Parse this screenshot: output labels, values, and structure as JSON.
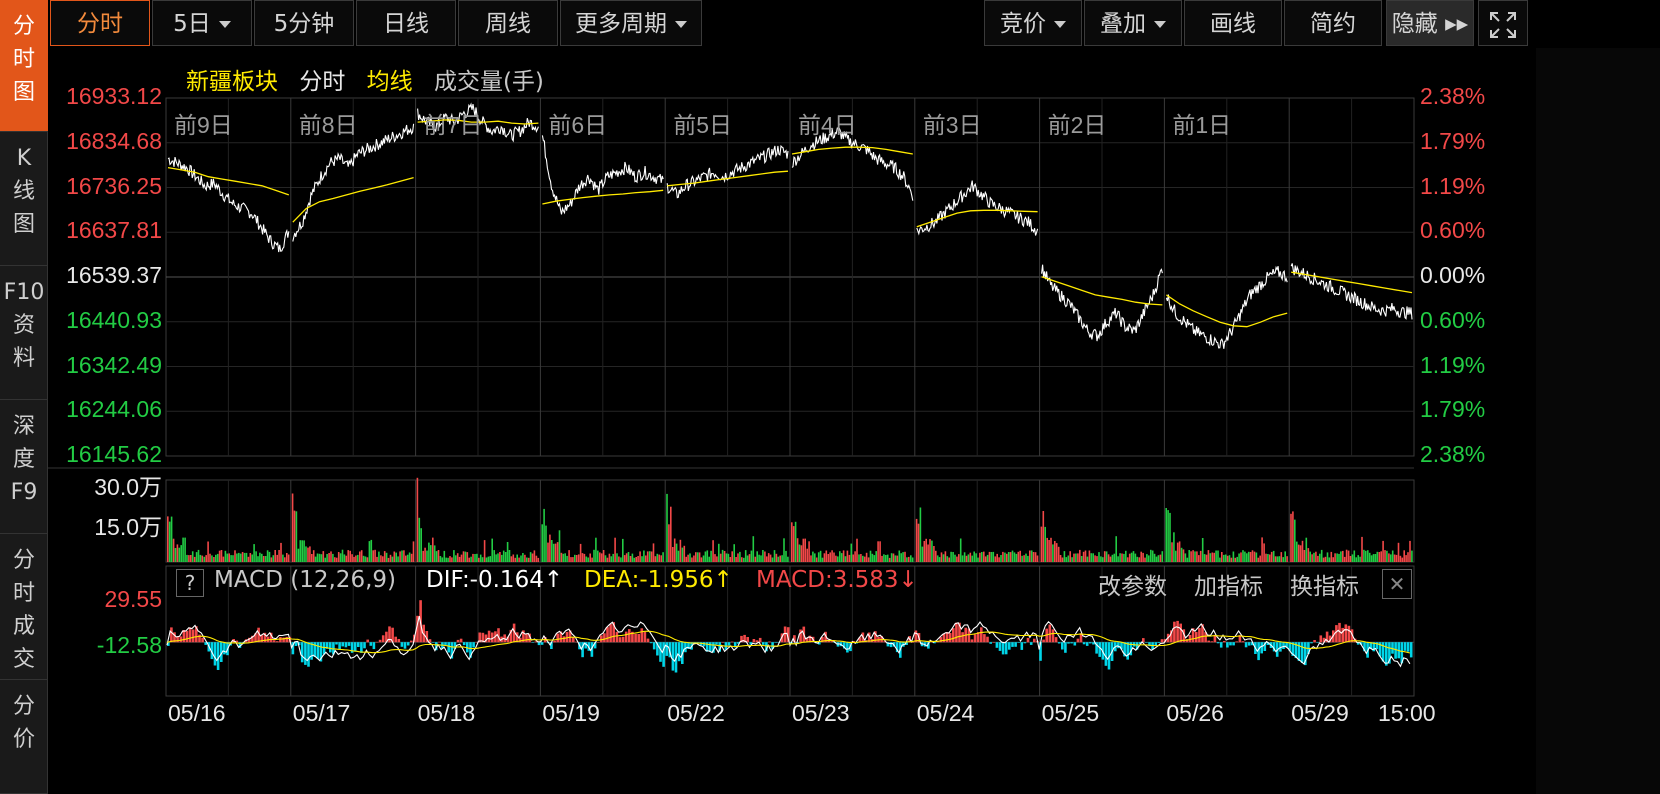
{
  "sidebar": {
    "items": [
      {
        "label": [
          "分",
          "时",
          "图"
        ],
        "active": true
      },
      {
        "label": [
          "K",
          "线",
          "图"
        ],
        "active": false
      },
      {
        "label": [
          "F10",
          "资",
          "料"
        ],
        "active": false
      },
      {
        "label": [
          "深",
          "度",
          "F9"
        ],
        "active": false
      },
      {
        "label": [
          "分",
          "时",
          "成",
          "交"
        ],
        "active": false
      },
      {
        "label": [
          "分",
          "价"
        ],
        "active": false
      }
    ]
  },
  "toolbar": {
    "tabs": [
      {
        "label": "分时",
        "active": true,
        "dropdown": false
      },
      {
        "label": "5日",
        "active": false,
        "dropdown": true
      },
      {
        "label": "5分钟",
        "active": false,
        "dropdown": false
      },
      {
        "label": "日线",
        "active": false,
        "dropdown": false
      },
      {
        "label": "周线",
        "active": false,
        "dropdown": false
      },
      {
        "label": "更多周期",
        "active": false,
        "dropdown": true
      }
    ],
    "right": [
      {
        "label": "竞价",
        "dropdown": true
      },
      {
        "label": "叠加",
        "dropdown": true
      },
      {
        "label": "画线",
        "dropdown": false
      },
      {
        "label": "简约",
        "dropdown": false
      },
      {
        "label": "隐藏 ▸▸",
        "dropdown": false
      }
    ],
    "expand_icon": "fullscreen-icon"
  },
  "legend": {
    "name": "新疆板块",
    "mode": "分时",
    "avg": "均线",
    "volume_label": "成交量(手)"
  },
  "macd": {
    "help": "?",
    "name": "MACD (12,26,9)",
    "dif": "DIF:-0.164↑",
    "dea": "DEA:-1.956↑",
    "macd": "MACD:3.583↓",
    "btn_params": "改参数",
    "btn_add": "加指标",
    "btn_switch": "换指标",
    "close": "✕"
  },
  "colors": {
    "up": "#f24848",
    "down": "#22cc44",
    "price_line": "#ffffff",
    "avg_line": "#ffea00",
    "macd_neg": "#00d5e8",
    "accent": "#e2561a"
  },
  "chart_data": {
    "type": "line",
    "title": "新疆板块 分时 5日",
    "y_ticks_left": [
      "16933.12",
      "16834.68",
      "16736.25",
      "16637.81",
      "16539.37",
      "16440.93",
      "16342.49",
      "16244.06",
      "16145.62"
    ],
    "y_ticks_right": [
      "2.38%",
      "1.79%",
      "1.19%",
      "0.60%",
      "0.00%",
      "0.60%",
      "1.19%",
      "1.79%",
      "2.38%"
    ],
    "ylim": [
      16145.62,
      16933.12
    ],
    "prev_close": 16539.37,
    "day_labels": [
      "前9日",
      "前8日",
      "前7日",
      "前6日",
      "前5日",
      "前4日",
      "前3日",
      "前2日",
      "前1日",
      ""
    ],
    "x_labels": [
      "05/16",
      "05/17",
      "05/18",
      "05/19",
      "05/22",
      "05/23",
      "05/24",
      "05/25",
      "05/26",
      "05/29",
      "15:00"
    ],
    "days": [
      {
        "price": [
          16800,
          16790,
          16780,
          16760,
          16740,
          16745,
          16720,
          16700,
          16690,
          16680,
          16650,
          16620,
          16600,
          16640
        ],
        "avg": [
          16780,
          16775,
          16770,
          16760,
          16755,
          16750,
          16745,
          16740,
          16730,
          16720
        ]
      },
      {
        "price": [
          16630,
          16660,
          16720,
          16760,
          16790,
          16800,
          16780,
          16810,
          16820,
          16830,
          16840,
          16850,
          16860,
          16870
        ],
        "avg": [
          16660,
          16690,
          16705,
          16712,
          16720,
          16728,
          16735,
          16742,
          16750,
          16758
        ]
      },
      {
        "price": [
          16900,
          16880,
          16870,
          16890,
          16880,
          16900,
          16910,
          16880,
          16860,
          16870,
          16850,
          16860,
          16880,
          16870
        ],
        "avg": [
          16880,
          16882,
          16885,
          16884,
          16880,
          16880,
          16882,
          16878,
          16876,
          16878
        ]
      },
      {
        "price": [
          16850,
          16740,
          16680,
          16700,
          16740,
          16760,
          16730,
          16760,
          16770,
          16780,
          16760,
          16770,
          16760,
          16750
        ],
        "avg": [
          16700,
          16706,
          16710,
          16714,
          16717,
          16720,
          16722,
          16725,
          16727,
          16730
        ]
      },
      {
        "price": [
          16740,
          16720,
          16740,
          16750,
          16760,
          16770,
          16760,
          16770,
          16780,
          16790,
          16800,
          16810,
          16820,
          16810
        ],
        "avg": [
          16740,
          16743,
          16746,
          16750,
          16754,
          16758,
          16762,
          16766,
          16770,
          16772
        ]
      },
      {
        "price": [
          16790,
          16810,
          16830,
          16840,
          16850,
          16860,
          16840,
          16830,
          16820,
          16800,
          16790,
          16780,
          16760,
          16720
        ],
        "avg": [
          16810,
          16815,
          16820,
          16823,
          16825,
          16825,
          16824,
          16820,
          16815,
          16810
        ]
      },
      {
        "price": [
          16640,
          16650,
          16660,
          16680,
          16700,
          16720,
          16740,
          16720,
          16700,
          16690,
          16680,
          16670,
          16660,
          16640
        ],
        "avg": [
          16650,
          16660,
          16670,
          16680,
          16685,
          16686,
          16686,
          16685,
          16684,
          16683
        ]
      },
      {
        "price": [
          16560,
          16520,
          16500,
          16480,
          16450,
          16420,
          16410,
          16440,
          16460,
          16430,
          16420,
          16460,
          16500,
          16560
        ],
        "avg": [
          16540,
          16530,
          16520,
          16510,
          16500,
          16495,
          16490,
          16484,
          16480,
          16478
        ]
      },
      {
        "price": [
          16500,
          16460,
          16440,
          16420,
          16410,
          16400,
          16390,
          16420,
          16460,
          16500,
          16520,
          16540,
          16550,
          16540
        ],
        "avg": [
          16500,
          16480,
          16465,
          16452,
          16440,
          16432,
          16430,
          16440,
          16452,
          16460
        ]
      },
      {
        "price": [
          16560,
          16550,
          16540,
          16530,
          16520,
          16510,
          16500,
          16490,
          16480,
          16470,
          16465,
          16470,
          16462,
          16460
        ],
        "avg": [
          16550,
          16545,
          16540,
          16535,
          16530,
          16525,
          16520,
          16515,
          16510,
          16505
        ]
      }
    ],
    "volume": {
      "ylim": [
        0,
        300000
      ],
      "y_ticks": [
        "30.0万",
        "15.0万"
      ]
    },
    "macd": {
      "y_ticks": [
        "29.55",
        "-12.58"
      ],
      "ylim": [
        -24,
        34
      ]
    }
  }
}
